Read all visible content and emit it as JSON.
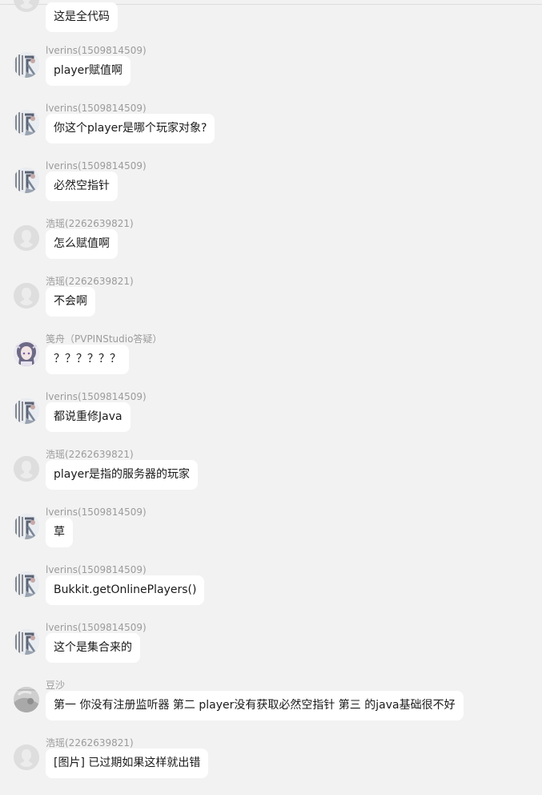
{
  "messages": [
    {
      "name": "",
      "text": "这是全代码",
      "avatar": "default-person-icon"
    },
    {
      "name": "lverins(1509814509)",
      "text": "player赋值啊",
      "avatar": "lverins-avatar"
    },
    {
      "name": "lverins(1509814509)",
      "text": "你这个player是哪个玩家对象?",
      "avatar": "lverins-avatar"
    },
    {
      "name": "lverins(1509814509)",
      "text": "必然空指针",
      "avatar": "lverins-avatar"
    },
    {
      "name": "浩瑶(2262639821)",
      "text": "怎么赋值啊",
      "avatar": "default-person-icon"
    },
    {
      "name": "浩瑶(2262639821)",
      "text": "不会啊",
      "avatar": "default-person-icon"
    },
    {
      "name": "笺舟（PVPINStudio答疑）",
      "text": "？？？？？？",
      "avatar": "anime-girl-avatar"
    },
    {
      "name": "lverins(1509814509)",
      "text": "都说重修Java",
      "avatar": "lverins-avatar"
    },
    {
      "name": "浩瑶(2262639821)",
      "text": "player是指的服务器的玩家",
      "avatar": "default-person-icon"
    },
    {
      "name": "lverins(1509814509)",
      "text": "草",
      "avatar": "lverins-avatar"
    },
    {
      "name": "lverins(1509814509)",
      "text": "Bukkit.getOnlinePlayers()",
      "avatar": "lverins-avatar"
    },
    {
      "name": "lverins(1509814509)",
      "text": "这个是集合来的",
      "avatar": "lverins-avatar"
    },
    {
      "name": "豆沙",
      "text": "第一 你没有注册监听器 第二 player没有获取必然空指针 第三 的java基础很不好",
      "avatar": "gray-photo-avatar"
    },
    {
      "name": "浩瑶(2262639821)",
      "text": "[图片] 已过期如果这样就出错",
      "avatar": "default-person-icon"
    }
  ]
}
